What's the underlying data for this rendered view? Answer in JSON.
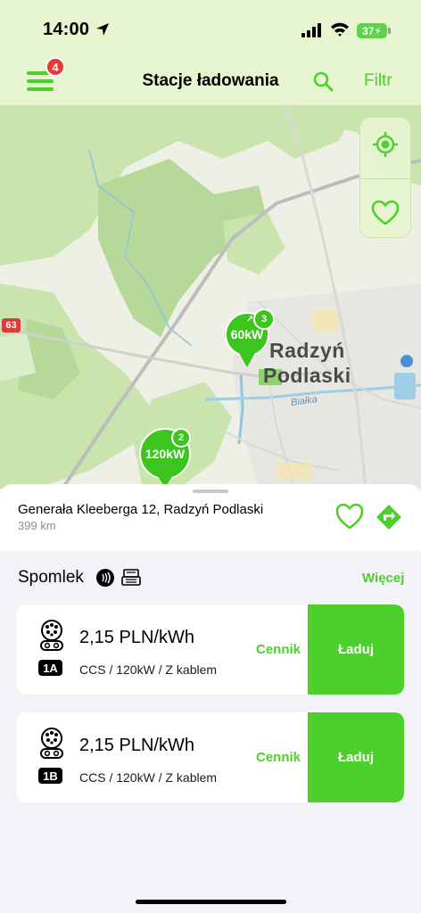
{
  "status_bar": {
    "time": "14:00",
    "battery": "37"
  },
  "header": {
    "menu_badge": "4",
    "title": "Stacje ładowania",
    "filter_label": "Filtr"
  },
  "map": {
    "town_line1": "Radzyń",
    "town_line2": "Podlaski",
    "road_number": "63",
    "river_name": "Białka",
    "pins": [
      {
        "power": "60kW",
        "count": "3"
      },
      {
        "power": "120kW",
        "count": "2"
      }
    ]
  },
  "station": {
    "address": "Generała Kleeberga 12, Radzyń Podlaski",
    "distance": "399 km"
  },
  "operator": {
    "name": "Spomlek",
    "more_label": "Więcej"
  },
  "connectors": [
    {
      "id": "1A",
      "price": "2,15 PLN/kWh",
      "spec": "CCS / 120kW / Z kablem",
      "tariff_label": "Cennik",
      "charge_label": "Ładuj"
    },
    {
      "id": "1B",
      "price": "2,15 PLN/kWh",
      "spec": "CCS / 120kW / Z kablem",
      "tariff_label": "Cennik",
      "charge_label": "Ładuj"
    }
  ],
  "colors": {
    "accent": "#4cd12c",
    "header_bg": "#e6f5cf",
    "badge": "#e53935"
  }
}
